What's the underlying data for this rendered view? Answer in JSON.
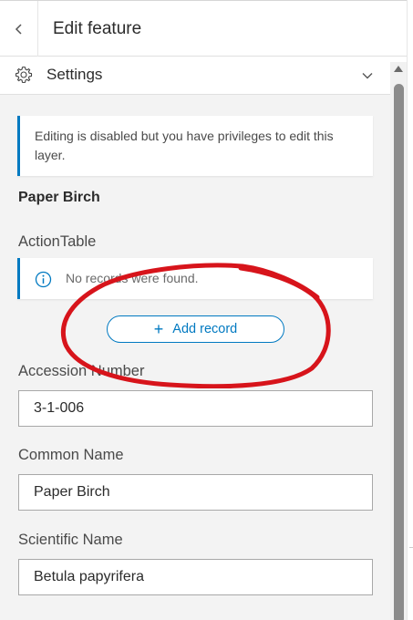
{
  "header": {
    "title": "Edit feature",
    "back_icon": "chevron-left-icon"
  },
  "settings": {
    "label": "Settings",
    "icon": "gear-icon",
    "expand_icon": "chevron-down-icon"
  },
  "notice": {
    "text": "Editing is disabled but you have privileges to edit this layer."
  },
  "feature": {
    "name": "Paper Birch"
  },
  "related_table": {
    "label": "ActionTable",
    "empty_message": "No records were found.",
    "info_icon": "info-icon",
    "add_button_label": "Add record",
    "add_icon": "plus-icon"
  },
  "fields": {
    "accession": {
      "label": "Accession Number",
      "value": "3-1-006"
    },
    "common": {
      "label": "Common Name",
      "value": "Paper Birch"
    },
    "scientific": {
      "label": "Scientific Name",
      "value": "Betula papyrifera"
    }
  },
  "colors": {
    "accent": "#0079c1",
    "annotation": "#d7141b",
    "content_bg": "#f3f3f3"
  }
}
